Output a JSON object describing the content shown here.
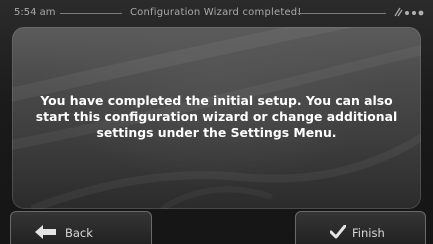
{
  "status_bar": {
    "time": "5:54 am",
    "title": "Configuration Wizard completed!",
    "icons": [
      "satellite-icon",
      "signal-dots-icon"
    ]
  },
  "dialog": {
    "message": "You have completed the initial setup. You can also start this configuration wizard or change additional settings under the Settings Menu."
  },
  "buttons": {
    "back_label": "Back",
    "finish_label": "Finish"
  },
  "colors": {
    "background": "#141414",
    "panel": "#4a4a4a",
    "text": "#ffffff",
    "status_text": "#a9a9a9"
  }
}
